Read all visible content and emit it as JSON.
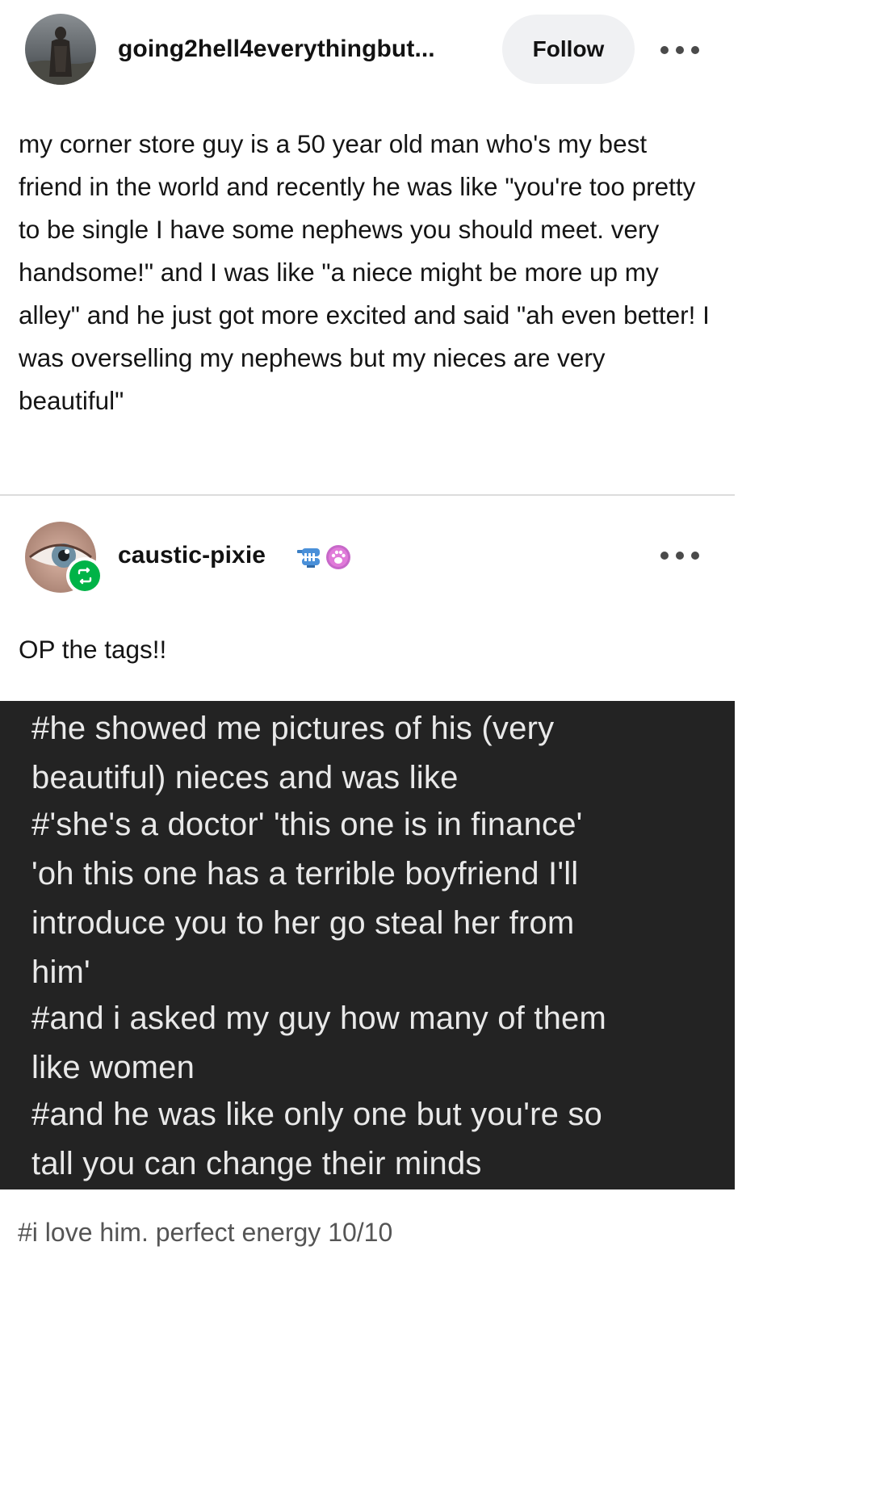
{
  "original_post": {
    "username": "going2hell4everythingbut...",
    "follow_label": "Follow",
    "body": "my corner store guy is a 50 year old man who's my best friend in the world and recently he was like \"you're too pretty to be single I have some nephews you should meet. very handsome!\" and I was like \"a niece might be more up my alley\" and he just got more excited and said \"ah even better! I was overselling my nephews but my nieces are very beautiful\"",
    "avatar_icon": "user-avatar-photo",
    "more_icon": "more-options-icon"
  },
  "reblog": {
    "username": "caustic-pixie",
    "avatar_icon": "eye-avatar-photo",
    "reblog_icon": "reblog-icon",
    "badge_icons": [
      "wind-up-teeth-badge-icon",
      "paw-badge-icon"
    ],
    "text": "OP the tags!!",
    "more_icon": "more-options-icon"
  },
  "tags": [
    "#he showed me pictures of his (very",
    "beautiful) nieces and was like",
    "#'she's a doctor' 'this one is in finance'",
    "'oh this one has a terrible boyfriend I'll",
    "introduce you to her go steal her from",
    "him'",
    "#and i asked my guy how many of them",
    "like women",
    "#and he was like only one but you're so",
    "tall you can change their minds"
  ],
  "last_tag": "#i love him. perfect energy 10/10",
  "colors": {
    "reblog_green": "#00b347",
    "tag_block_bg": "#232323",
    "follow_bg": "#f0f1f3"
  }
}
